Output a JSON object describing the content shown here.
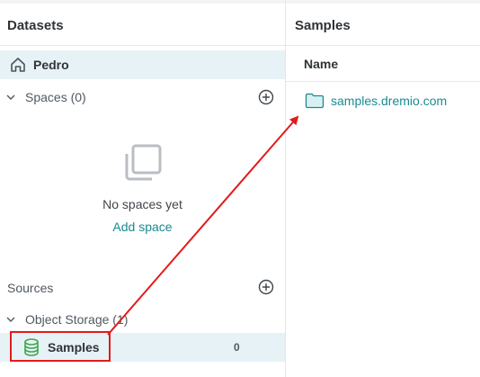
{
  "left_panel": {
    "title": "Datasets",
    "home": {
      "label": "Pedro",
      "icon": "home-icon"
    },
    "spaces": {
      "label": "Spaces (0)",
      "empty_text": "No spaces yet",
      "add_link": "Add space"
    },
    "sources": {
      "label": "Sources",
      "groups": [
        {
          "label": "Object Storage (1)",
          "items": [
            {
              "label": "Samples",
              "count": "0",
              "icon": "database-icon"
            }
          ]
        }
      ]
    }
  },
  "right_panel": {
    "title": "Samples",
    "column_header": "Name",
    "rows": [
      {
        "label": "samples.dremio.com",
        "icon": "folder-icon"
      }
    ]
  },
  "annotation": {
    "color": "#e21b1b"
  },
  "colors": {
    "accent": "#1a8a92",
    "selected_bg": "#e7f2f7"
  }
}
